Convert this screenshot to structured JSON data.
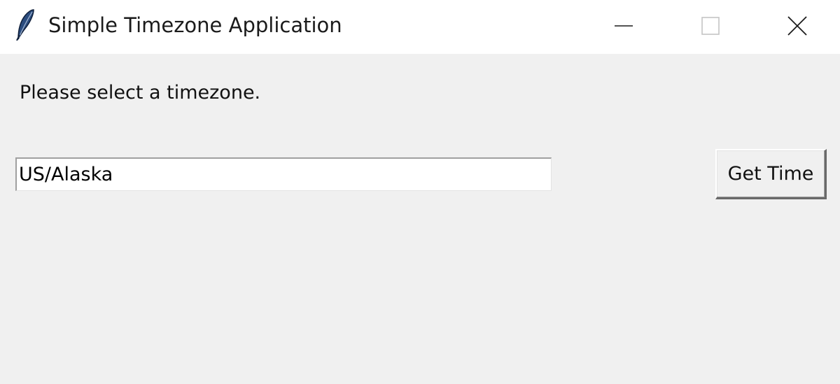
{
  "window": {
    "title": "Simple Timezone Application",
    "icon": "feather-icon",
    "controls": [
      "minimize-icon",
      "maximize-icon",
      "close-icon"
    ]
  },
  "main": {
    "prompt_label": "Please select a timezone.",
    "timezone_input": {
      "value": "US/Alaska"
    },
    "get_time_button_label": "Get Time"
  },
  "colors": {
    "titlebar_bg": "#ffffff",
    "window_bg": "#f0f0f0",
    "input_bg": "#ffffff",
    "text": "#111111"
  }
}
